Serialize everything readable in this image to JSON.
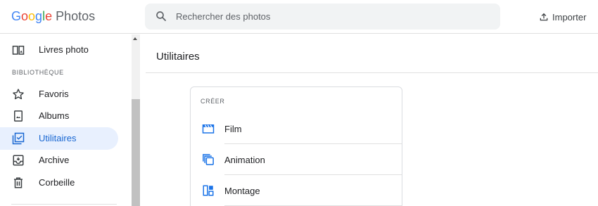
{
  "app": {
    "logo_letters": [
      "G",
      "o",
      "o",
      "g",
      "l",
      "e"
    ],
    "product": "Photos"
  },
  "search": {
    "placeholder": "Rechercher des photos",
    "icon": "search-icon"
  },
  "header": {
    "import_label": "Importer",
    "import_icon": "upload-icon"
  },
  "sidebar": {
    "top_item": {
      "label": "Livres photo",
      "icon": "photo-book-icon"
    },
    "section_label": "BIBLIOTHÈQUE",
    "items": [
      {
        "label": "Favoris",
        "icon": "star-icon",
        "active": false
      },
      {
        "label": "Albums",
        "icon": "album-icon",
        "active": false
      },
      {
        "label": "Utilitaires",
        "icon": "utilities-icon",
        "active": true
      },
      {
        "label": "Archive",
        "icon": "archive-icon",
        "active": false
      },
      {
        "label": "Corbeille",
        "icon": "trash-icon",
        "active": false
      }
    ]
  },
  "main": {
    "title": "Utilitaires",
    "card": {
      "section_label": "CRÉER",
      "tools": [
        {
          "label": "Film",
          "icon": "movie-icon"
        },
        {
          "label": "Animation",
          "icon": "animation-icon"
        },
        {
          "label": "Montage",
          "icon": "collage-icon"
        }
      ]
    }
  },
  "colors": {
    "accent": "#1967d2",
    "active_bg": "#e8f0fe",
    "tool_icon": "#1a73e8",
    "text": "#202124",
    "muted": "#5f6368"
  }
}
